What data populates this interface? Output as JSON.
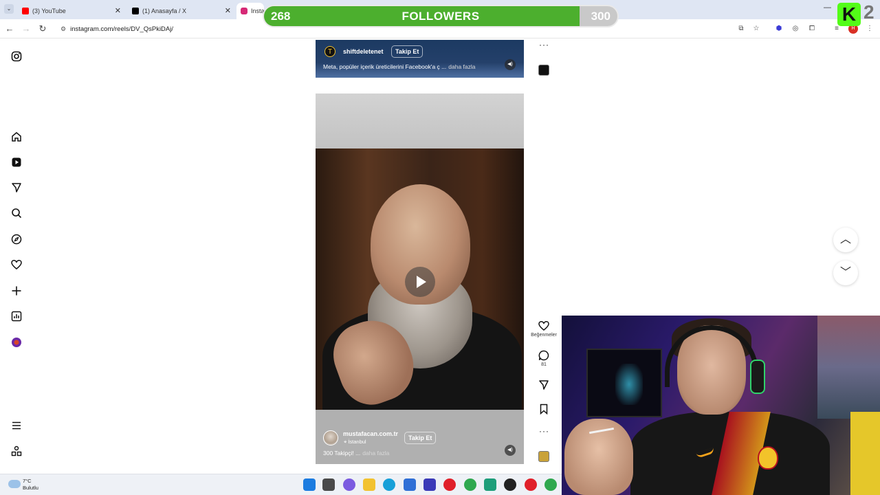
{
  "browser": {
    "tabs": [
      {
        "title": "(3) YouTube",
        "color": "#ff0000"
      },
      {
        "title": "(1) Anasayfa / X",
        "color": "#000000"
      },
      {
        "title": "Instag",
        "color": "#d62976"
      }
    ],
    "url": "instagram.com/reels/DV_QsPkiDAj/"
  },
  "overlay": {
    "current": "268",
    "label": "FOLLOWERS",
    "goal": "300",
    "progress": 0.893,
    "kick_number": "2"
  },
  "sidebar": {
    "icons": [
      "instagram-icon",
      "home-icon",
      "reels-icon",
      "send-icon",
      "search-icon",
      "explore-icon",
      "heart-icon",
      "create-icon",
      "dashboard-icon",
      "profile-icon",
      "menu-icon",
      "apps-icon"
    ]
  },
  "reels": {
    "top": {
      "username": "shiftdeletenet",
      "follow_label": "Takip Et",
      "caption": "Meta, popüler içerik üreticilerini Facebook'a ç ...",
      "more": "daha fazla"
    },
    "main": {
      "username": "mustafacan.com.tr",
      "location": "İstanbul",
      "follow_label": "Takip Et",
      "caption": "300 Takipçi! ...",
      "more": "daha fazla"
    }
  },
  "actions": {
    "likes_label": "Beğenmeler",
    "comments_count": "81"
  },
  "taskbar": {
    "temp": "7°C",
    "condition": "Bulutlu"
  }
}
